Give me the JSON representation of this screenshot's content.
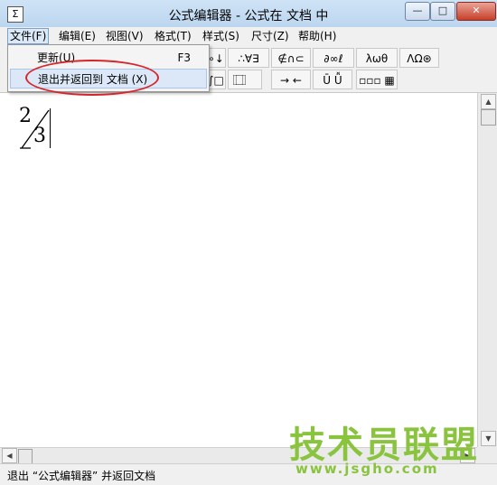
{
  "window": {
    "title": "公式编辑器 - 公式在 文档  中",
    "app_icon": "Σ"
  },
  "titlebar_buttons": {
    "minimize": "—",
    "maximize": "□",
    "close": "✕"
  },
  "menu": [
    "文件(F)",
    "编辑(E)",
    "视图(V)",
    "格式(T)",
    "样式(S)",
    "尺寸(Z)",
    "帮助(H)"
  ],
  "file_menu": {
    "items": [
      {
        "label": "更新(U)",
        "shortcut": "F3"
      },
      {
        "label": "退出并返回到 文档 (X)",
        "shortcut": ""
      }
    ]
  },
  "toolbar": {
    "row1": [
      "∘↓",
      "∴∀∃",
      "∉∩⊂",
      "∂∞ℓ",
      "λωθ",
      "ΛΩ⊛"
    ],
    "row2": [
      "∫□",
      "⃞ ⃞",
      "→ ←",
      "Ū Ǚ",
      "▫▫▫ ▦"
    ]
  },
  "document": {
    "fraction": {
      "numerator": "2",
      "denominator": "3"
    }
  },
  "scrollbar": {
    "up": "▲",
    "down": "▼",
    "left": "◀",
    "right": "▶"
  },
  "status": {
    "text": "退出 “公式编辑器” 并返回文档"
  },
  "watermark": {
    "main": "技术员联盟",
    "url": "www.jsgho.com"
  }
}
